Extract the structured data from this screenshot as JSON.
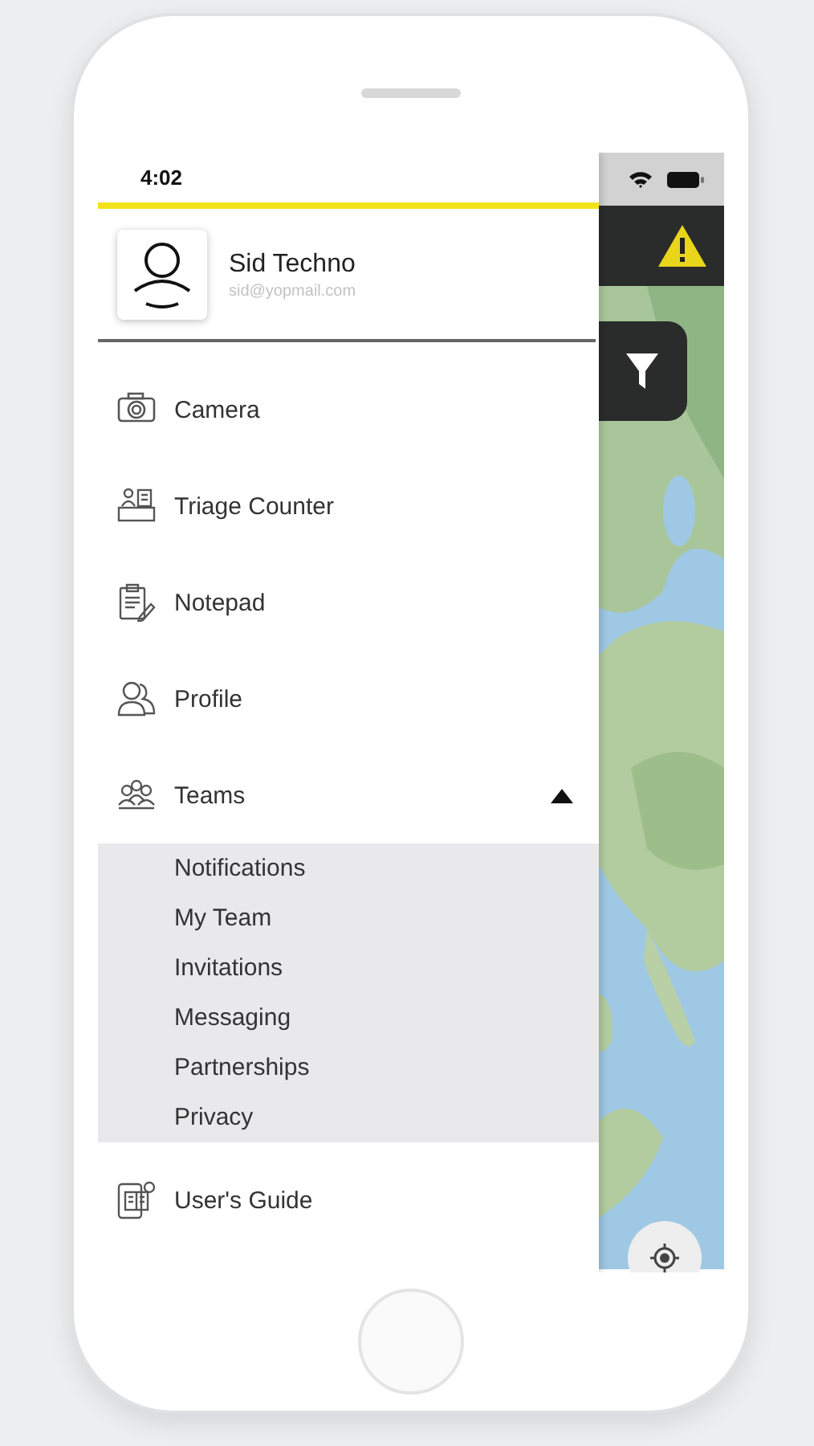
{
  "status_bar": {
    "time": "4:02"
  },
  "drawer": {
    "user": {
      "name": "Sid Techno",
      "email": "sid@yopmail.com"
    },
    "menu": [
      {
        "kind": "item",
        "label": "Camera"
      },
      {
        "kind": "item",
        "label": "Triage Counter"
      },
      {
        "kind": "item",
        "label": "Notepad"
      },
      {
        "kind": "item",
        "label": "Profile"
      },
      {
        "kind": "group",
        "label": "Teams",
        "expanded": true,
        "children": [
          {
            "label": "Notifications"
          },
          {
            "label": "My Team"
          },
          {
            "label": "Invitations"
          },
          {
            "label": "Messaging"
          },
          {
            "label": "Partnerships"
          },
          {
            "label": "Privacy"
          }
        ]
      },
      {
        "kind": "item",
        "label": "User's Guide"
      }
    ]
  }
}
